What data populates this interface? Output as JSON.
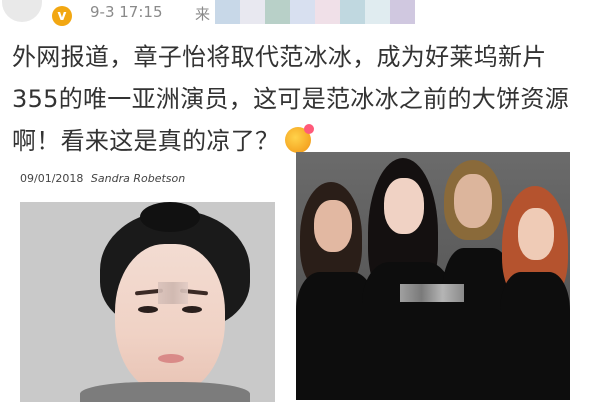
{
  "post": {
    "timestamp": "9-3 17:15",
    "source_prefix": "来",
    "verified_mark": "v",
    "text": "外网报道，章子怡将取代范冰冰，成为好莱坞新片355的唯一亚洲演员，这可是范冰冰之前的大饼资源啊！看来这是真的凉了？",
    "emoji": "kiss-face-emoji"
  },
  "left_image": {
    "caption_date": "09/01/2018",
    "caption_author": "Sandra Robetson"
  },
  "colors": {
    "text": "#333333",
    "meta": "#8a8a8a",
    "verified": "#f2a712",
    "mosaic": [
      "#c8d8e8",
      "#e8e8f0",
      "#b8d0c8",
      "#d8e0f0",
      "#f0e0e8",
      "#c0d8e0",
      "#e0ecf0",
      "#d0c8e0"
    ]
  }
}
